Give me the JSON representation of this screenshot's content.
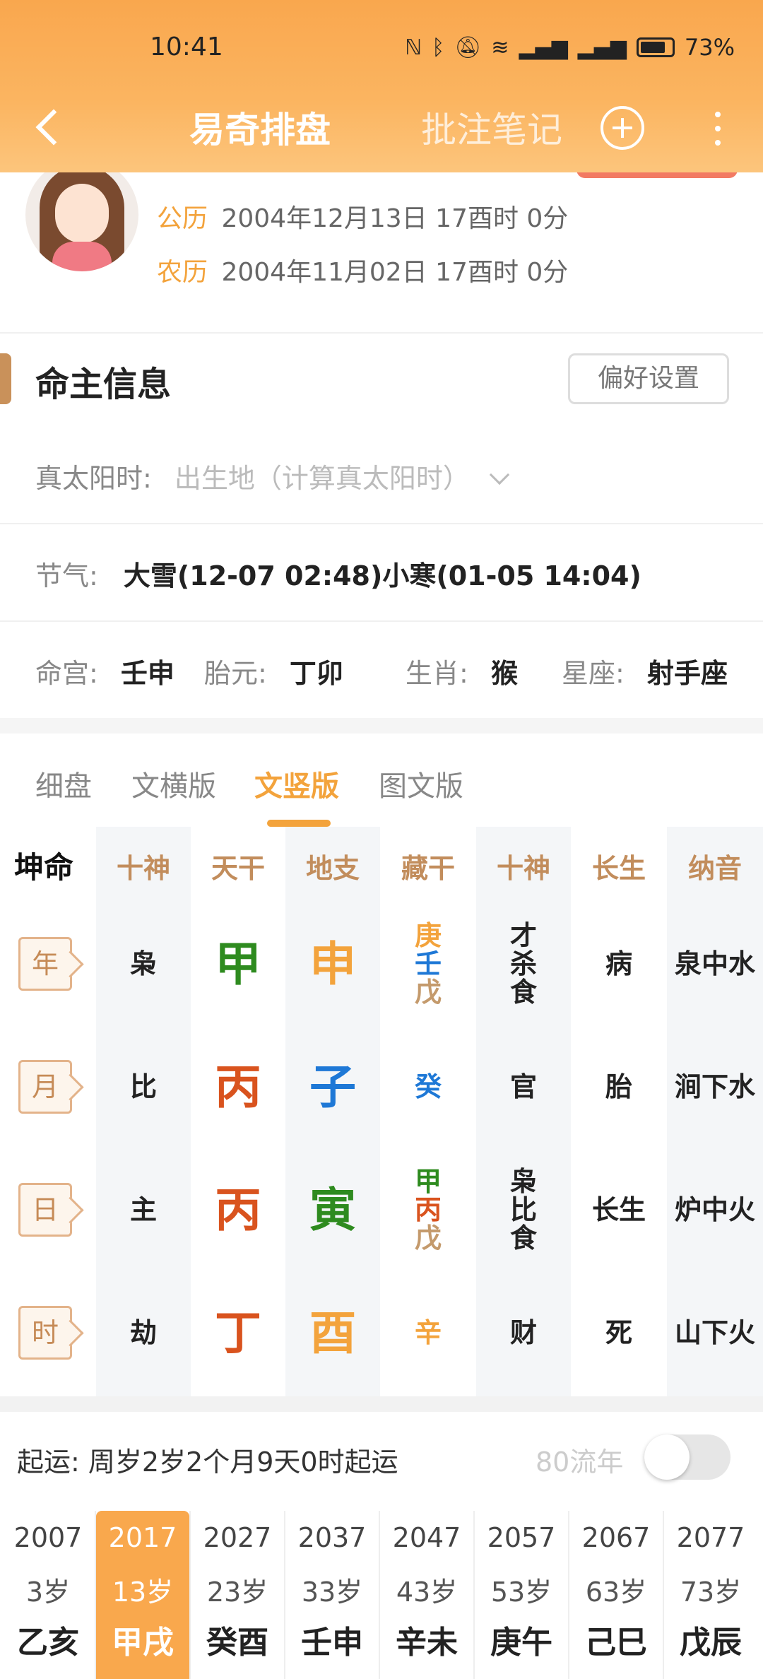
{
  "status": {
    "time": "10:41",
    "battery": "73%"
  },
  "nav": {
    "title": "易奇排盘",
    "notes": "批注笔记"
  },
  "profile": {
    "solar_label": "公历",
    "solar_value": "2004年12月13日 17酉时 0分",
    "lunar_label": "农历",
    "lunar_value": "2004年11月02日 17酉时 0分"
  },
  "info": {
    "title": "命主信息",
    "pref_button": "偏好设置",
    "true_solar_label": "真太阳时:",
    "true_solar_placeholder": "出生地（计算真太阳时）",
    "jieqi_label": "节气:",
    "jieqi_value": "大雪(12-07 02:48)小寒(01-05 14:04)",
    "minggong_label": "命宫:",
    "minggong_value": "壬申",
    "taiyuan_label": "胎元:",
    "taiyuan_value": "丁卯",
    "shengxiao_label": "生肖:",
    "shengxiao_value": "猴",
    "xingzuo_label": "星座:",
    "xingzuo_value": "射手座"
  },
  "tabs": [
    "细盘",
    "文横版",
    "文竖版",
    "图文版"
  ],
  "grid": {
    "corner": "坤命",
    "headers": [
      "十神",
      "天干",
      "地支",
      "藏干",
      "十神",
      "长生",
      "纳音"
    ],
    "rows": [
      {
        "label": "年",
        "shishen": "枭",
        "tiangan": "甲",
        "dizhi": "申",
        "canggan": [
          "庚",
          "壬",
          "戊"
        ],
        "shishen2": [
          "才",
          "杀",
          "食"
        ],
        "changsheng": "病",
        "nayin": "泉中水"
      },
      {
        "label": "月",
        "shishen": "比",
        "tiangan": "丙",
        "dizhi": "子",
        "canggan": [
          "癸"
        ],
        "shishen2": [
          "官"
        ],
        "changsheng": "胎",
        "nayin": "涧下水"
      },
      {
        "label": "日",
        "shishen": "主",
        "tiangan": "丙",
        "dizhi": "寅",
        "canggan": [
          "甲",
          "丙",
          "戊"
        ],
        "shishen2": [
          "枭",
          "比",
          "食"
        ],
        "changsheng": "长生",
        "nayin": "炉中火"
      },
      {
        "label": "时",
        "shishen": "劫",
        "tiangan": "丁",
        "dizhi": "酉",
        "canggan": [
          "辛"
        ],
        "shishen2": [
          "财"
        ],
        "changsheng": "死",
        "nayin": "山下火"
      }
    ]
  },
  "qiyun": {
    "text": "起运:  周岁2岁2个月9天0时起运",
    "liunian_label": "80流年"
  },
  "dayun": [
    {
      "year": "2007",
      "age": "3岁",
      "gz": "乙亥"
    },
    {
      "year": "2017",
      "age": "13岁",
      "gz": "甲戌"
    },
    {
      "year": "2027",
      "age": "23岁",
      "gz": "癸酉"
    },
    {
      "year": "2037",
      "age": "33岁",
      "gz": "壬申"
    },
    {
      "year": "2047",
      "age": "43岁",
      "gz": "辛未"
    },
    {
      "year": "2057",
      "age": "53岁",
      "gz": "庚午"
    },
    {
      "year": "2067",
      "age": "63岁",
      "gz": "己巳"
    },
    {
      "year": "2077",
      "age": "73岁",
      "gz": "戊辰"
    }
  ],
  "colors": {
    "accent": "#f3a33c",
    "wood": "#2e8b1f",
    "fire": "#d9531e",
    "water": "#1e78d6",
    "metal": "#f3a33c",
    "earth": "#c49a6c",
    "header_text": "#c28d5c"
  }
}
